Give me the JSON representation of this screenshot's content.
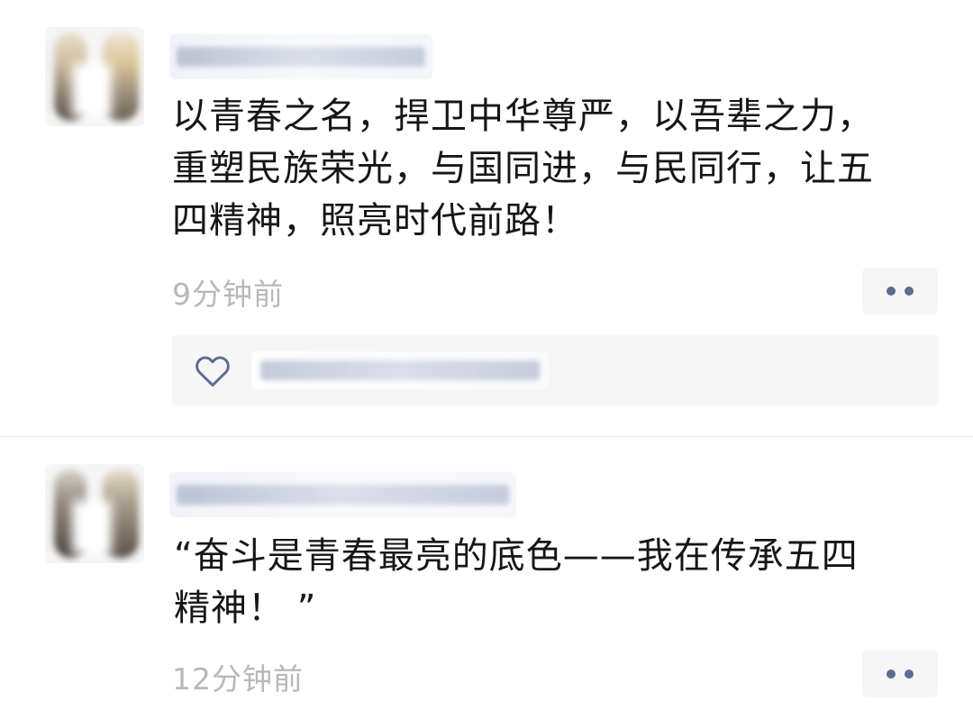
{
  "posts": [
    {
      "content": "以青春之名，捍卫中华尊严，以吾辈之力，重塑民族荣光，与国同进，与民同行，让五四精神，照亮时代前路！",
      "time": "9分钟前"
    },
    {
      "content": "“奋斗是青春最亮的底色——我在传承五四精神！ ”",
      "time": "12分钟前"
    }
  ],
  "colors": {
    "link_blue": "#5d6b8e",
    "time_gray": "#b8b8b8",
    "text": "#161616",
    "panel_bg": "#f6f6f7"
  },
  "icons": {
    "like": "heart-outline-icon",
    "more": "more-dots-icon"
  }
}
